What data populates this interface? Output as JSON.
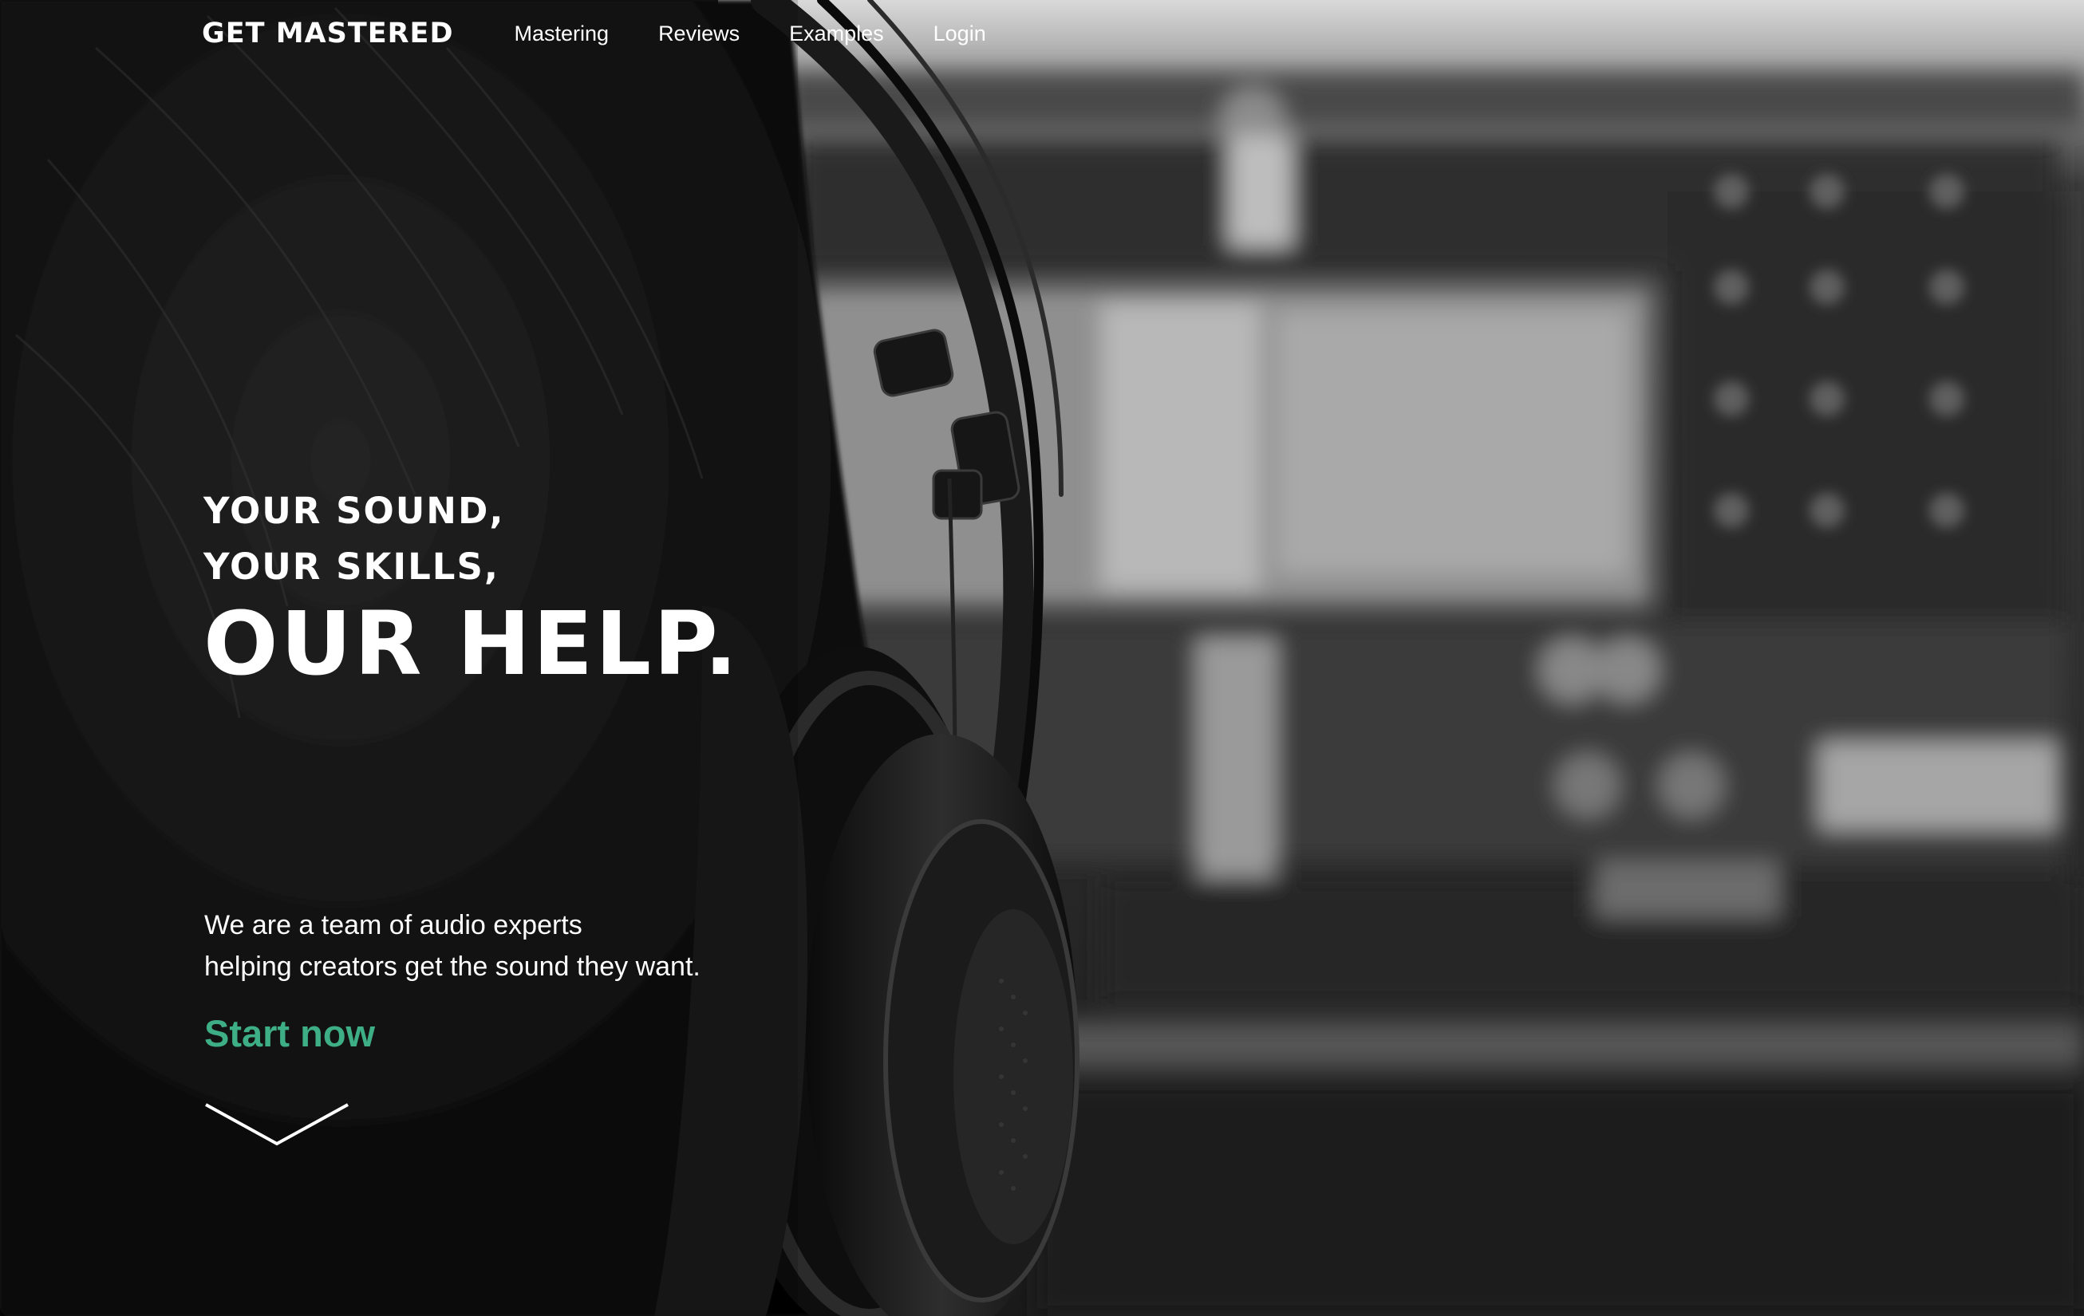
{
  "nav": {
    "brand": "GET MASTERED",
    "links": [
      {
        "label": "Mastering"
      },
      {
        "label": "Reviews"
      },
      {
        "label": "Examples"
      },
      {
        "label": "Login"
      }
    ]
  },
  "hero": {
    "headline_lines": [
      "YOUR SOUND,",
      "YOUR SKILLS,"
    ],
    "headline_big": "OUR HELP.",
    "description_lines": [
      "We are a team of audio experts",
      "helping creators get the sound they want."
    ],
    "cta_label": "Start now",
    "scroll_icon": "chevron-down-icon"
  },
  "colors": {
    "accent": "#3eae86",
    "text": "#ffffff",
    "background": "#0b0b0b"
  }
}
